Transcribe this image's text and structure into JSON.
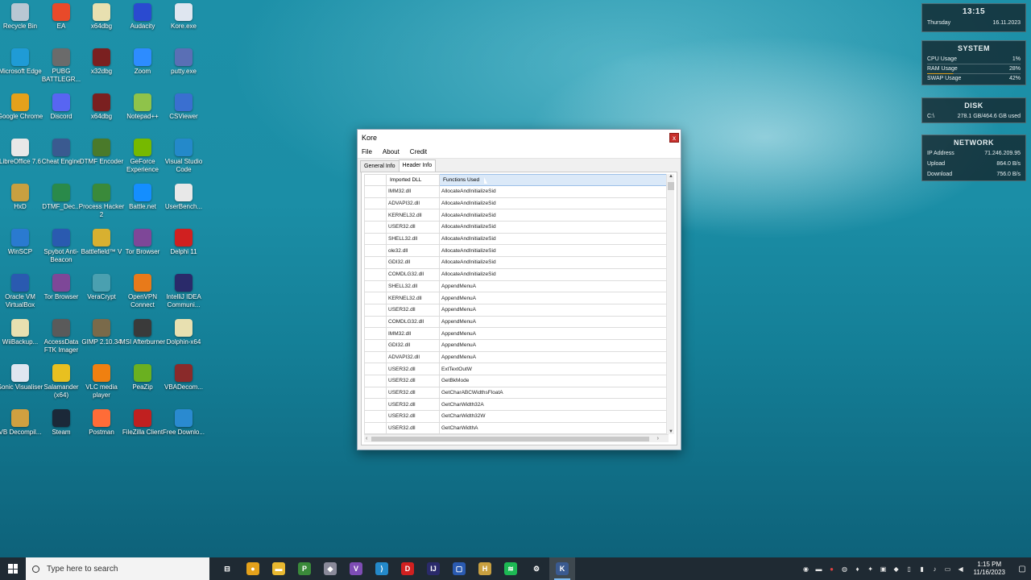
{
  "desktop": {
    "icons": [
      {
        "label": "Recycle Bin",
        "icon": "recycle-bin-icon",
        "color": "#b9c7d3"
      },
      {
        "label": "EA",
        "icon": "ea-icon",
        "color": "#e84a2a"
      },
      {
        "label": "x64dbg",
        "icon": "file-icon",
        "color": "#e8e0b0"
      },
      {
        "label": "Audacity",
        "icon": "audacity-icon",
        "color": "#2a4ad0"
      },
      {
        "label": "Kore.exe",
        "icon": "exe-icon",
        "color": "#dfe6f0"
      },
      {
        "label": "Microsoft Edge",
        "icon": "edge-icon",
        "color": "#1f9bd6"
      },
      {
        "label": "PUBG BATTLEGR...",
        "icon": "pubg-icon",
        "color": "#6b6b6b"
      },
      {
        "label": "x32dbg",
        "icon": "bug-icon",
        "color": "#7a2020"
      },
      {
        "label": "Zoom",
        "icon": "zoom-icon",
        "color": "#2d8cff"
      },
      {
        "label": "putty.exe",
        "icon": "putty-icon",
        "color": "#5a6fb5"
      },
      {
        "label": "Google Chrome",
        "icon": "chrome-icon",
        "color": "#e4a11b"
      },
      {
        "label": "Discord",
        "icon": "discord-icon",
        "color": "#5865f2"
      },
      {
        "label": "x64dbg",
        "icon": "bug-icon",
        "color": "#7a2020"
      },
      {
        "label": "Notepad++",
        "icon": "notepad-icon",
        "color": "#8fc34a"
      },
      {
        "label": "CSViewer",
        "icon": "csviewer-icon",
        "color": "#3a6fd0"
      },
      {
        "label": "LibreOffice 7.6",
        "icon": "libreoffice-icon",
        "color": "#e8e8e8"
      },
      {
        "label": "Cheat Engine",
        "icon": "cheat-engine-icon",
        "color": "#3a5a90"
      },
      {
        "label": "DTMF Encoder",
        "icon": "dtmf-icon",
        "color": "#4a7a2a"
      },
      {
        "label": "GeForce Experience",
        "icon": "geforce-icon",
        "color": "#76b900"
      },
      {
        "label": "Visual Studio Code",
        "icon": "vscode-icon",
        "color": "#2489ca"
      },
      {
        "label": "HxD",
        "icon": "hxd-icon",
        "color": "#c8a040"
      },
      {
        "label": "DTMF_Dec...",
        "icon": "dtmf-icon",
        "color": "#2a8a4a"
      },
      {
        "label": "Process Hacker 2",
        "icon": "process-hacker-icon",
        "color": "#3a8a3a"
      },
      {
        "label": "Battle.net",
        "icon": "battlenet-icon",
        "color": "#148eff"
      },
      {
        "label": "UserBench...",
        "icon": "userbench-icon",
        "color": "#e8e8e8"
      },
      {
        "label": "WinSCP",
        "icon": "winscp-icon",
        "color": "#2a7ad0"
      },
      {
        "label": "Spybot Anti-Beacon",
        "icon": "spybot-icon",
        "color": "#2a5ab0"
      },
      {
        "label": "Battlefield™ V",
        "icon": "battlefield-icon",
        "color": "#d8b030"
      },
      {
        "label": "Tor Browser",
        "icon": "tor-icon",
        "color": "#7e4798"
      },
      {
        "label": "Delphi 11",
        "icon": "delphi-icon",
        "color": "#d02020"
      },
      {
        "label": "Oracle VM VirtualBox",
        "icon": "virtualbox-icon",
        "color": "#2a5ab0"
      },
      {
        "label": "Tor Browser",
        "icon": "tor-icon",
        "color": "#7e4798"
      },
      {
        "label": "VeraCrypt",
        "icon": "veracrypt-icon",
        "color": "#4aa0b0"
      },
      {
        "label": "OpenVPN Connect",
        "icon": "openvpn-icon",
        "color": "#e87a1a"
      },
      {
        "label": "IntelliJ IDEA Communi...",
        "icon": "intellij-icon",
        "color": "#2a2a6a"
      },
      {
        "label": "WiiBackup...",
        "icon": "file-icon",
        "color": "#e8e0b0"
      },
      {
        "label": "AccessData FTK Imager",
        "icon": "ftk-icon",
        "color": "#5a5a5a"
      },
      {
        "label": "GIMP 2.10.34",
        "icon": "gimp-icon",
        "color": "#7a6a4a"
      },
      {
        "label": "MSI Afterburner",
        "icon": "msi-icon",
        "color": "#3a3a3a"
      },
      {
        "label": "Dolphin-x64",
        "icon": "file-icon",
        "color": "#e8e0b0"
      },
      {
        "label": "Sonic Visualiser",
        "icon": "sonic-icon",
        "color": "#dfe6f0"
      },
      {
        "label": "Salamander (x64)",
        "icon": "salamander-icon",
        "color": "#e8c020"
      },
      {
        "label": "VLC media player",
        "icon": "vlc-icon",
        "color": "#f08010"
      },
      {
        "label": "PeaZip",
        "icon": "peazip-icon",
        "color": "#6ab020"
      },
      {
        "label": "VBADecom...",
        "icon": "vbadecom-icon",
        "color": "#8a2a2a"
      },
      {
        "label": "VB Decompil...",
        "icon": "vb-icon",
        "color": "#d0a040"
      },
      {
        "label": "Steam",
        "icon": "steam-icon",
        "color": "#1b2838"
      },
      {
        "label": "Postman",
        "icon": "postman-icon",
        "color": "#ff6c37"
      },
      {
        "label": "FileZilla Client",
        "icon": "filezilla-icon",
        "color": "#c02020"
      },
      {
        "label": "Free Downlo...",
        "icon": "fdm-icon",
        "color": "#2a8ad0"
      }
    ]
  },
  "widgets": {
    "clock": {
      "time": "13:15",
      "day": "Thursday",
      "date": "16.11.2023"
    },
    "system": {
      "title": "SYSTEM",
      "cpu_label": "CPU Usage",
      "cpu_value": "1%",
      "ram_label": "RAM Usage",
      "ram_value": "28%",
      "swap_label": "SWAP Usage",
      "swap_value": "42%"
    },
    "disk": {
      "title": "DISK",
      "drive": "C:\\",
      "usage": "278.1 GB/464.6 GB used"
    },
    "network": {
      "title": "NETWORK",
      "ip_label": "IP Address",
      "ip_value": "71.246.209.95",
      "upload_label": "Upload",
      "upload_value": "864.0 B/s",
      "download_label": "Download",
      "download_value": "756.0 B/s"
    }
  },
  "window": {
    "title": "Kore",
    "close_label": "x",
    "menu": [
      "File",
      "About",
      "Credit"
    ],
    "tabs": [
      "General Info",
      "Header Info"
    ],
    "active_tab": 1,
    "columns": [
      "Imported DLL",
      "Functions Used"
    ],
    "rows": [
      [
        "IMM32.dll",
        "AllocateAndInitializeSid"
      ],
      [
        "ADVAPI32.dll",
        "AllocateAndInitializeSid"
      ],
      [
        "KERNEL32.dll",
        "AllocateAndInitializeSid"
      ],
      [
        "USER32.dll",
        "AllocateAndInitializeSid"
      ],
      [
        "SHELL32.dll",
        "AllocateAndInitializeSid"
      ],
      [
        "ole32.dll",
        "AllocateAndInitializeSid"
      ],
      [
        "GDI32.dll",
        "AllocateAndInitializeSid"
      ],
      [
        "COMDLG32.dll",
        "AllocateAndInitializeSid"
      ],
      [
        "SHELL32.dll",
        "AppendMenuA"
      ],
      [
        "KERNEL32.dll",
        "AppendMenuA"
      ],
      [
        "USER32.dll",
        "AppendMenuA"
      ],
      [
        "COMDLG32.dll",
        "AppendMenuA"
      ],
      [
        "IMM32.dll",
        "AppendMenuA"
      ],
      [
        "GDI32.dll",
        "AppendMenuA"
      ],
      [
        "ADVAPI32.dll",
        "AppendMenuA"
      ],
      [
        "USER32.dll",
        "ExtTextOutW"
      ],
      [
        "USER32.dll",
        "GetBkMode"
      ],
      [
        "USER32.dll",
        "GetCharABCWidthsFloatA"
      ],
      [
        "USER32.dll",
        "GetCharWidth32A"
      ],
      [
        "USER32.dll",
        "GetCharWidth32W"
      ],
      [
        "USER32.dll",
        "GetCharWidthA"
      ]
    ]
  },
  "taskbar": {
    "search_placeholder": "Type here to search",
    "time": "1:15 PM",
    "date": "11/16/2023",
    "pinned": [
      {
        "name": "task-view-icon",
        "color": "#1f2a33",
        "glyph": "⊟"
      },
      {
        "name": "chrome-icon",
        "color": "#e4a11b",
        "glyph": "●"
      },
      {
        "name": "file-explorer-icon",
        "color": "#e8b830",
        "glyph": "▬"
      },
      {
        "name": "process-hacker-icon",
        "color": "#3a8a3a",
        "glyph": "P"
      },
      {
        "name": "app-icon",
        "color": "#8a8a9a",
        "glyph": "◆"
      },
      {
        "name": "visual-studio-icon",
        "color": "#7e4db5",
        "glyph": "V"
      },
      {
        "name": "vscode-icon",
        "color": "#2489ca",
        "glyph": "⟩"
      },
      {
        "name": "delphi-icon",
        "color": "#d02020",
        "glyph": "D"
      },
      {
        "name": "intellij-icon",
        "color": "#2a2a6a",
        "glyph": "IJ"
      },
      {
        "name": "virtualbox-icon",
        "color": "#2a5ab0",
        "glyph": "▢"
      },
      {
        "name": "hxd-icon",
        "color": "#c8a040",
        "glyph": "H"
      },
      {
        "name": "spotify-icon",
        "color": "#1db954",
        "glyph": "≋"
      },
      {
        "name": "settings-icon",
        "color": "#1f2a33",
        "glyph": "⚙"
      },
      {
        "name": "kore-icon",
        "color": "#3a5a90",
        "glyph": "K"
      }
    ],
    "active_index": 13
  }
}
